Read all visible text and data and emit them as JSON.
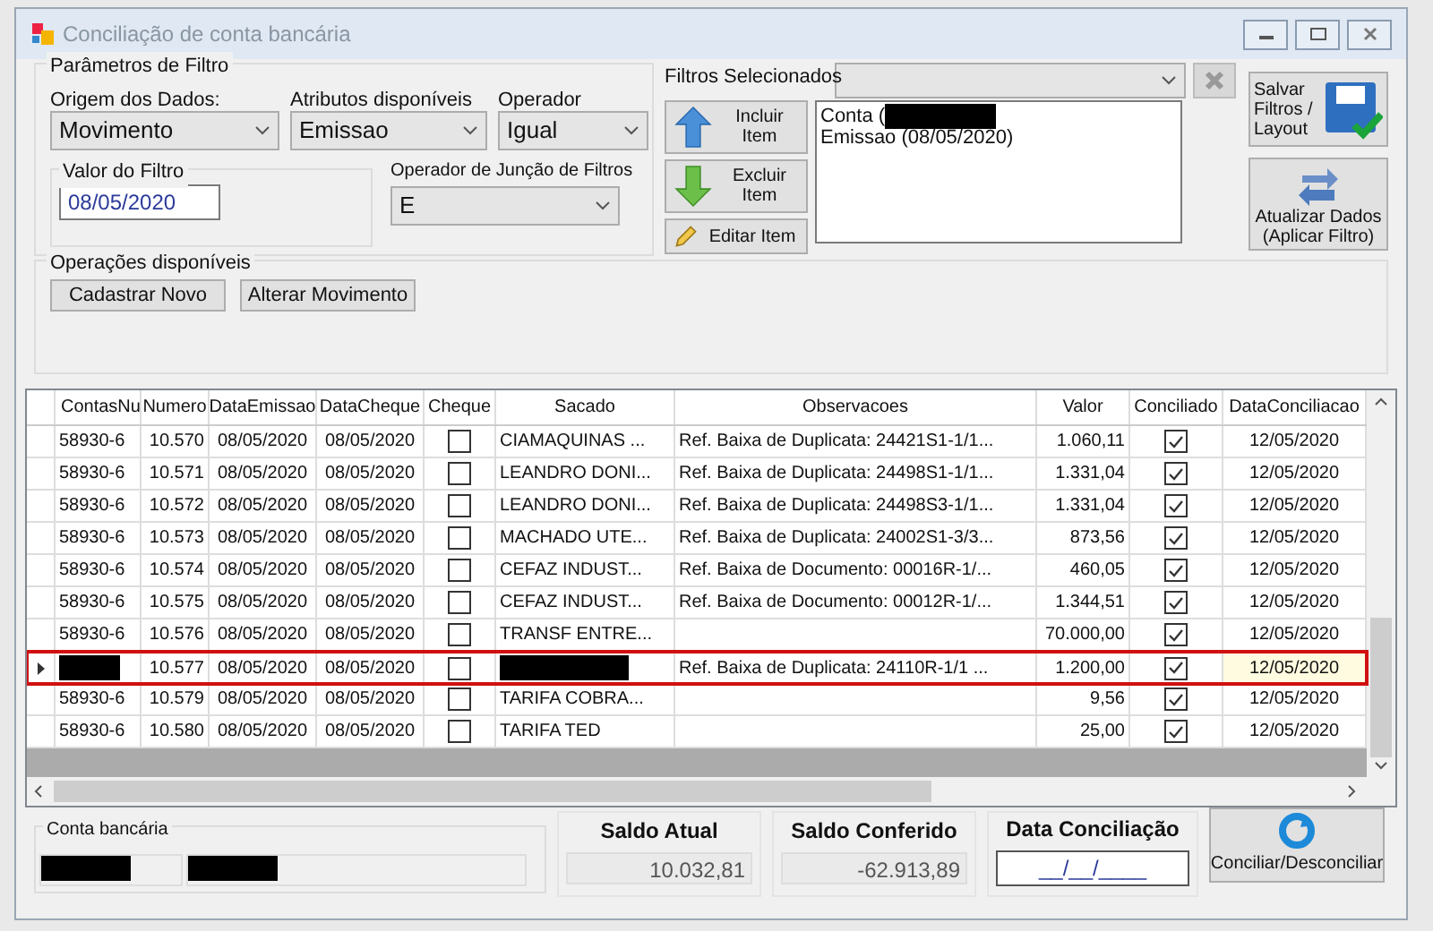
{
  "window": {
    "title": "Conciliação de conta bancária"
  },
  "filter_params": {
    "title": "Parâmetros de Filtro",
    "fields": [
      {
        "label": "Origem dos Dados:",
        "value": "Movimento"
      },
      {
        "label": "Atributos disponíveis",
        "value": "Emissao"
      },
      {
        "label": "Operador",
        "value": "Igual"
      }
    ],
    "filter_value": {
      "title": "Valor do Filtro",
      "value": "08/05/2020"
    },
    "join": {
      "label": "Operador de Junção de Filtros",
      "value": "E"
    }
  },
  "selected_filters": {
    "title": "Filtros Selecionados",
    "buttons": [
      {
        "kind": "add",
        "label": "Incluir Item"
      },
      {
        "kind": "remove",
        "label": "Excluir Item"
      },
      {
        "kind": "edit",
        "label": "Editar Item"
      }
    ],
    "items": [
      {
        "text": "Conta (",
        "redacted": true
      },
      {
        "text": "Emissao (08/05/2020)",
        "redacted": false
      }
    ]
  },
  "side_buttons": [
    {
      "kind": "save",
      "label": "Salvar Filtros / Layout"
    },
    {
      "kind": "refresh",
      "label": "Atualizar Dados (Aplicar Filtro)"
    }
  ],
  "operations": {
    "title": "Operações disponíveis",
    "buttons": [
      "Cadastrar Novo",
      "Alterar Movimento"
    ]
  },
  "table": {
    "columns": [
      "ContasNu",
      "Numero",
      "DataEmissao",
      "DataCheque",
      "Cheque",
      "Sacado",
      "Observacoes",
      "Valor",
      "Conciliado",
      "DataConciliacao"
    ],
    "rows": [
      {
        "contas": "58930-6",
        "numero": "10.570",
        "emissao": "08/05/2020",
        "data_cheque": "08/05/2020",
        "cheque": false,
        "sacado": "CIAMAQUINAS ...",
        "obs": "Ref. Baixa de Duplicata: 24421S1-1/1...",
        "valor": "1.060,11",
        "conciliado": true,
        "data_conciliacao": "12/05/2020",
        "selected": false
      },
      {
        "contas": "58930-6",
        "numero": "10.571",
        "emissao": "08/05/2020",
        "data_cheque": "08/05/2020",
        "cheque": false,
        "sacado": "LEANDRO DONI...",
        "obs": "Ref. Baixa de Duplicata: 24498S1-1/1...",
        "valor": "1.331,04",
        "conciliado": true,
        "data_conciliacao": "12/05/2020",
        "selected": false
      },
      {
        "contas": "58930-6",
        "numero": "10.572",
        "emissao": "08/05/2020",
        "data_cheque": "08/05/2020",
        "cheque": false,
        "sacado": "LEANDRO DONI...",
        "obs": "Ref. Baixa de Duplicata: 24498S3-1/1...",
        "valor": "1.331,04",
        "conciliado": true,
        "data_conciliacao": "12/05/2020",
        "selected": false
      },
      {
        "contas": "58930-6",
        "numero": "10.573",
        "emissao": "08/05/2020",
        "data_cheque": "08/05/2020",
        "cheque": false,
        "sacado": "MACHADO UTE...",
        "obs": "Ref. Baixa de Duplicata: 24002S1-3/3...",
        "valor": "873,56",
        "conciliado": true,
        "data_conciliacao": "12/05/2020",
        "selected": false
      },
      {
        "contas": "58930-6",
        "numero": "10.574",
        "emissao": "08/05/2020",
        "data_cheque": "08/05/2020",
        "cheque": false,
        "sacado": "CEFAZ INDUST...",
        "obs": "Ref. Baixa de Documento: 00016R-1/...",
        "valor": "460,05",
        "conciliado": true,
        "data_conciliacao": "12/05/2020",
        "selected": false
      },
      {
        "contas": "58930-6",
        "numero": "10.575",
        "emissao": "08/05/2020",
        "data_cheque": "08/05/2020",
        "cheque": false,
        "sacado": "CEFAZ INDUST...",
        "obs": "Ref. Baixa de Documento: 00012R-1/...",
        "valor": "1.344,51",
        "conciliado": true,
        "data_conciliacao": "12/05/2020",
        "selected": false
      },
      {
        "contas": "58930-6",
        "numero": "10.576",
        "emissao": "08/05/2020",
        "data_cheque": "08/05/2020",
        "cheque": false,
        "sacado": "TRANSF ENTRE...",
        "valor": "70.000,00",
        "conciliado": true,
        "data_conciliacao": "12/05/2020",
        "selected": false
      },
      {
        "numero": "10.577",
        "emissao": "08/05/2020",
        "data_cheque": "08/05/2020",
        "cheque": false,
        "obs": "Ref. Baixa de Duplicata: 24110R-1/1 ...",
        "valor": "1.200,00",
        "conciliado": true,
        "data_conciliacao": "12/05/2020",
        "selected": true,
        "redacted": true
      },
      {
        "contas": "58930-6",
        "numero": "10.579",
        "emissao": "08/05/2020",
        "data_cheque": "08/05/2020",
        "cheque": false,
        "sacado": "TARIFA COBRA...",
        "valor": "9,56",
        "conciliado": true,
        "data_conciliacao": "12/05/2020",
        "selected": false
      },
      {
        "contas": "58930-6",
        "numero": "10.580",
        "emissao": "08/05/2020",
        "data_cheque": "08/05/2020",
        "cheque": false,
        "sacado": "TARIFA TED",
        "valor": "25,00",
        "conciliado": true,
        "data_conciliacao": "12/05/2020",
        "selected": false
      }
    ]
  },
  "footer": {
    "account_label": "Conta bancária",
    "account_redacted": true,
    "saldo_atual": {
      "label": "Saldo Atual",
      "value": "10.032,81"
    },
    "saldo_conferido": {
      "label": "Saldo Conferido",
      "value": "-62.913,89"
    },
    "data_conciliacao": {
      "label": "Data Conciliação",
      "value": "__/__/____"
    },
    "button": "Conciliar/Desconciliar"
  }
}
